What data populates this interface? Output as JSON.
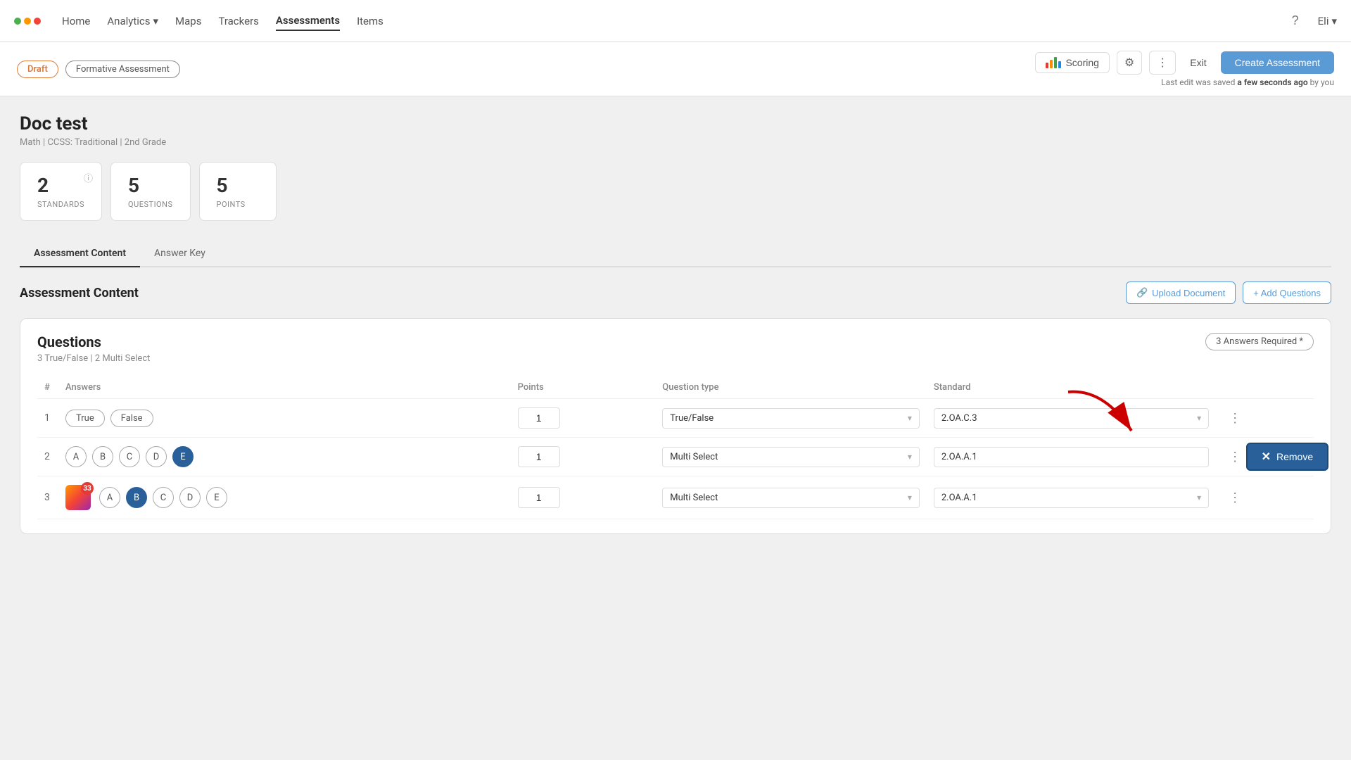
{
  "nav": {
    "home": "Home",
    "analytics": "Analytics",
    "maps": "Maps",
    "trackers": "Trackers",
    "assessments": "Assessments",
    "items": "Items",
    "user": "Eli"
  },
  "toolbar": {
    "badge_draft": "Draft",
    "badge_formative": "Formative Assessment",
    "scoring_label": "Scoring",
    "exit_label": "Exit",
    "create_label": "Create Assessment",
    "save_text": "Last edit was saved",
    "save_time": "a few seconds ago",
    "save_by": "by you"
  },
  "doc": {
    "title": "Doc test",
    "meta": "Math  |  CCSS: Traditional  |  2nd Grade"
  },
  "stats": [
    {
      "num": "2",
      "label": "STANDARDS"
    },
    {
      "num": "5",
      "label": "QUESTIONS"
    },
    {
      "num": "5",
      "label": "POINTS"
    }
  ],
  "tabs": [
    {
      "label": "Assessment Content",
      "active": true
    },
    {
      "label": "Answer Key",
      "active": false
    }
  ],
  "content": {
    "title": "Assessment Content",
    "upload_label": "Upload Document",
    "add_label": "+ Add Questions"
  },
  "questions": {
    "title": "Questions",
    "subtitle": "3 True/False | 2 Multi Select",
    "answers_required": "3 Answers Required *",
    "col_hash": "#",
    "col_answers": "Answers",
    "col_points": "Points",
    "col_question_type": "Question type",
    "col_standard": "Standard",
    "rows": [
      {
        "num": "1",
        "answers": [
          "True",
          "False"
        ],
        "answer_type": "pill",
        "points": "1",
        "question_type": "True/False",
        "standard": "2.OA.C.3",
        "selected": []
      },
      {
        "num": "2",
        "answers": [
          "A",
          "B",
          "C",
          "D",
          "E"
        ],
        "answer_type": "circle",
        "points": "1",
        "question_type": "Multi Select",
        "standard": "2.OA.A.1",
        "selected": [
          "E"
        ],
        "show_remove": true
      },
      {
        "num": "3",
        "answers": [
          "A",
          "B",
          "C",
          "D",
          "E"
        ],
        "answer_type": "circle",
        "points": "1",
        "question_type": "Multi Select",
        "standard": "2.OA.A.1",
        "selected": [
          "B"
        ],
        "has_logo": true
      }
    ],
    "remove_label": "Remove"
  }
}
